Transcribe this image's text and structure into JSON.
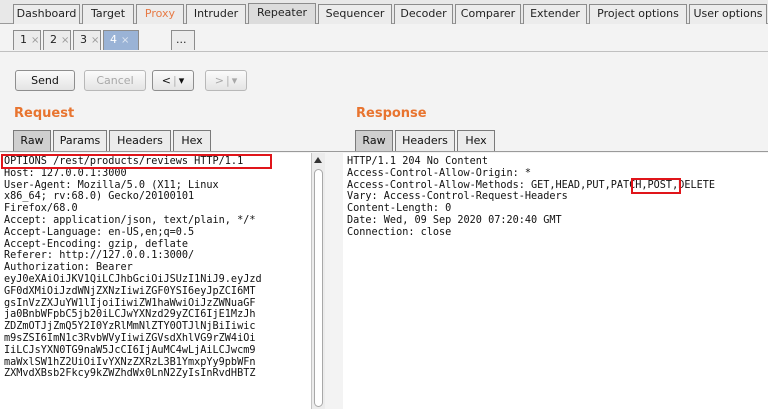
{
  "main_tabs": [
    {
      "label": "Dashboard"
    },
    {
      "label": "Target"
    },
    {
      "label": "Proxy"
    },
    {
      "label": "Intruder"
    },
    {
      "label": "Repeater"
    },
    {
      "label": "Sequencer"
    },
    {
      "label": "Decoder"
    },
    {
      "label": "Comparer"
    },
    {
      "label": "Extender"
    },
    {
      "label": "Project options"
    },
    {
      "label": "User options"
    }
  ],
  "active_main_tab": "Repeater",
  "sub_tabs": [
    {
      "label": "1",
      "close": "×"
    },
    {
      "label": "2",
      "close": "×"
    },
    {
      "label": "3",
      "close": "×"
    },
    {
      "label": "4",
      "close": "×"
    },
    {
      "label": "..."
    }
  ],
  "toolbar": {
    "send_label": "Send",
    "cancel_label": "Cancel",
    "back_label": "<",
    "back_dropdown": "▾",
    "forward_label": ">",
    "forward_dropdown": "▾"
  },
  "request": {
    "title": "Request",
    "tabs": [
      {
        "label": "Raw"
      },
      {
        "label": "Params"
      },
      {
        "label": "Headers"
      },
      {
        "label": "Hex"
      }
    ],
    "lines": [
      "OPTIONS /rest/products/reviews HTTP/1.1",
      "Host: 127.0.0.1:3000",
      "User-Agent: Mozilla/5.0 (X11; Linux",
      "x86_64; rv:68.0) Gecko/20100101",
      "Firefox/68.0",
      "Accept: application/json, text/plain, */*",
      "Accept-Language: en-US,en;q=0.5",
      "Accept-Encoding: gzip, deflate",
      "Referer: http://127.0.0.1:3000/",
      "Authorization: Bearer",
      "eyJ0eXAiOiJKV1QiLCJhbGciOiJSUzI1NiJ9.eyJzd",
      "GF0dXMiOiJzdWNjZXNzIiwiZGF0YSI6eyJpZCI6MT",
      "gsInVzZXJuYW1lIjoiIiwiZW1haWwiOiJzZWNuaGF",
      "ja0BnbWFpbC5jb20iLCJwYXNzd29yZCI6IjE1MzJh",
      "ZDZmOTJjZmQ5Y2I0YzRlMmNlZTY0OTJlNjBiIiwic",
      "m9sZSI6ImN1c3RvbWVyIiwiZGVsdXhlVG9rZW4iOi",
      "IiLCJsYXN0TG9naW5JcCI6IjAuMC4wLjAiLCJwcm9",
      "maWxlSW1hZ2UiOiIvYXNzZXRzL3B1YmxpYy9pbWFn",
      "ZXMvdXBsb2Fkcy9kZWZhdWx0LnN2ZyIsInRvdHBTZ"
    ]
  },
  "response": {
    "title": "Response",
    "tabs": [
      {
        "label": "Raw"
      },
      {
        "label": "Headers"
      },
      {
        "label": "Hex"
      }
    ],
    "lines": [
      "HTTP/1.1 204 No Content",
      "Access-Control-Allow-Origin: *",
      "Access-Control-Allow-Methods: GET,HEAD,PUT,PATCH,POST,DELETE",
      "Vary: Access-Control-Request-Headers",
      "Content-Length: 0",
      "Date: Wed, 09 Sep 2020 07:20:40 GMT",
      "Connection: close"
    ]
  },
  "colors": {
    "accent": "#e8742f",
    "highlight": "#e0151a",
    "active_subtab": "#9ab3d6"
  }
}
